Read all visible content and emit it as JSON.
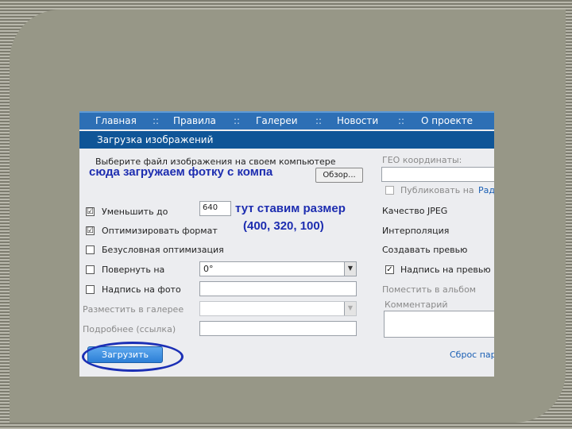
{
  "nav": {
    "items": [
      "Главная",
      "Правила",
      "Галереи",
      "Новости",
      "О проекте"
    ],
    "separator": "::"
  },
  "section_title": "Загрузка изображений",
  "file": {
    "label": "Выберите файл изображения на своем компьютере",
    "browse_label": "Обзор..."
  },
  "annotations": {
    "upload_hint": "сюда загружаем фотку с компа",
    "size_hint_line1": "тут ставим размер",
    "size_hint_line2": "(400, 320, 100)"
  },
  "left_options": {
    "reduce": {
      "label": "Уменьшить до",
      "value": "640",
      "checked": "☑"
    },
    "optimize": {
      "label": "Оптимизировать формат",
      "checked": "☑"
    },
    "unconditional": {
      "label": "Безусловная оптимизация"
    },
    "rotate": {
      "label": "Повернуть на",
      "value": "0°"
    },
    "caption": {
      "label": "Надпись на фото"
    },
    "gallery": {
      "label": "Разместить в галерее"
    },
    "more_link": {
      "label": "Подробнее (ссылка)"
    }
  },
  "right_options": {
    "geo_label": "ГЕО координаты:",
    "publish_label": "Публиковать на",
    "publish_link": "Рад",
    "jpeg_quality": "Качество JPEG",
    "interpolation": "Интерполяция",
    "create_preview": "Создавать превью",
    "preview_caption": "Надпись на превью",
    "album_label": "Поместить в альбом",
    "comment_label": "Комментарий",
    "reset_link": "Сброс пар"
  },
  "upload_button": "Загрузить",
  "colors": {
    "nav_bg": "#2d6fb5",
    "title_bg": "#0f5597",
    "annotation": "#1d2db0"
  }
}
